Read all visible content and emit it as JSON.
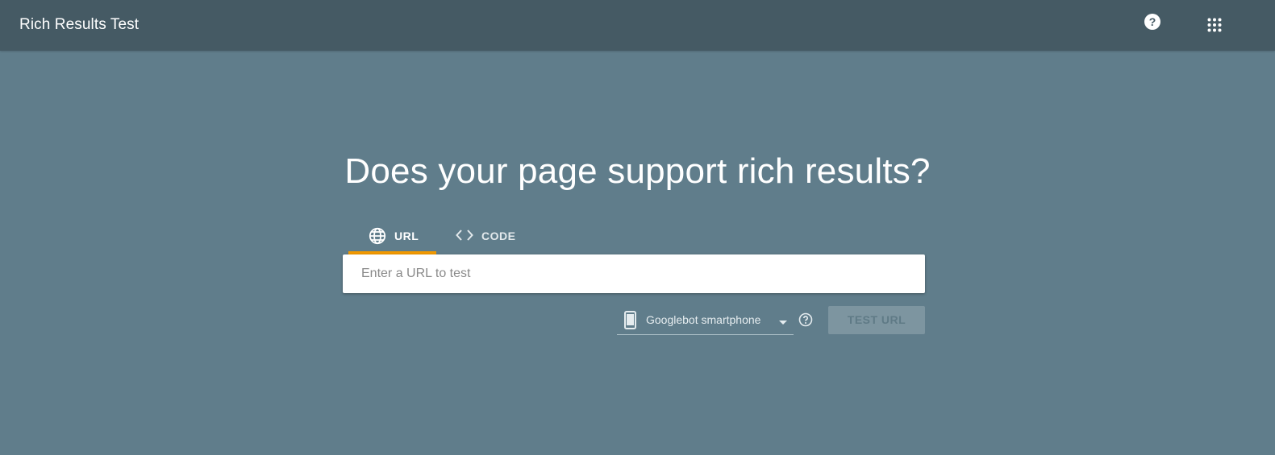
{
  "header": {
    "title": "Rich Results Test",
    "help_label": "?",
    "help_icon": "help-icon",
    "apps_icon": "apps-grid-icon"
  },
  "main": {
    "headline": "Does your page support rich results?",
    "tabs": [
      {
        "label": "URL",
        "icon": "globe-icon",
        "selected": true
      },
      {
        "label": "CODE",
        "icon": "code-icon",
        "selected": false
      }
    ],
    "url_input": {
      "value": "",
      "placeholder": "Enter a URL to test"
    },
    "device_select": {
      "selected": "Googlebot smartphone",
      "icon": "smartphone-icon"
    },
    "info_icon": "help-outline-icon",
    "test_button": {
      "label": "TEST URL",
      "enabled": false
    }
  },
  "colors": {
    "header_bg": "#455a64",
    "page_bg": "#607d8b",
    "tab_indicator": "#f29900",
    "button_disabled_bg": "#7d95a0"
  }
}
